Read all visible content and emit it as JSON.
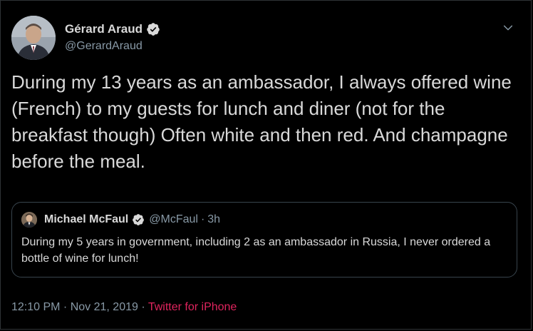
{
  "tweet": {
    "author": {
      "name": "Gérard Araud",
      "handle": "@GerardAraud",
      "verified": true,
      "avatar_icon": "user-avatar"
    },
    "text": "During my 13 years as an ambassador, I always offered wine (French) to my guests for lunch and diner (not for the breakfast though) Often white and then red. And champagne before the meal.",
    "quoted": {
      "author_name": "Michael McFaul",
      "handle": "@McFaul",
      "separator": "·",
      "time": "3h",
      "verified": true,
      "text": "During my 5 years in government, including 2 as an ambassador in Russia, I never ordered a bottle of wine for lunch!"
    },
    "timestamp": "12:10 PM · Nov 21, 2019",
    "separator": "·",
    "source": "Twitter for iPhone"
  },
  "colors": {
    "background": "#000000",
    "text": "#d9d9d9",
    "secondary": "#8899a6",
    "source_link": "#e0245e",
    "border": "#38444d"
  }
}
